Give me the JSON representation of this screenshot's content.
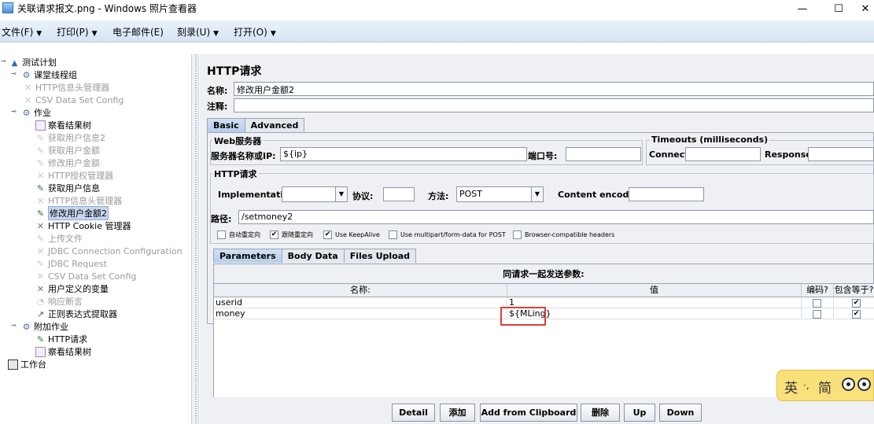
{
  "window": {
    "title": "关联请求报文.png - Windows 照片查看器",
    "minimize": "—",
    "maximize": "☐",
    "close": "✕"
  },
  "menubar": {
    "items": [
      "文件(F)",
      "打印(P)",
      "电子邮件(E)",
      "刻录(U)",
      "打开(O)"
    ]
  },
  "tree": {
    "items": [
      "测试计划",
      "课堂线程组",
      "HTTP信息头管理器",
      "CSV Data Set Config",
      "作业",
      "察看结果树",
      "获取用户信息2",
      "获取用户金额",
      "修改用户金额",
      "HTTP授权管理器",
      "获取用户信息",
      "HTTP信息头管理器",
      "修改用户金额2",
      "HTTP Cookie 管理器",
      "上传文件",
      "JDBC Connection Configuration",
      "JDBC Request",
      "CSV Data Set Config",
      "用户定义的变量",
      "响应断言",
      "正则表达式提取器",
      "附加作业",
      "HTTP请求",
      "察看结果树",
      "工作台"
    ]
  },
  "panel": {
    "title": "HTTP请求",
    "name_label": "名称:",
    "name_value": "修改用户金额2",
    "comment_label": "注释:",
    "tabs": [
      "Basic",
      "Advanced"
    ],
    "web_server": {
      "title": "Web服务器",
      "server_label": "服务器名称或IP:",
      "server_value": "${ip}",
      "port_label": "端口号:"
    },
    "timeouts": {
      "title": "Timeouts (milliseconds)",
      "connect_label": "Connect:",
      "response_label": "Response:"
    },
    "http_request": {
      "title": "HTTP请求",
      "implementation_label": "Implementation:",
      "protocol_label": "协议:",
      "method_label": "方法:",
      "method_value": "POST",
      "encoding_label": "Content encoding:",
      "path_label": "路径:",
      "path_value": "/setmoney2"
    },
    "checkboxes": [
      {
        "label": "自动重定向",
        "checked": false,
        "mark": ""
      },
      {
        "label": "跟随重定向",
        "checked": true,
        "mark": "✔"
      },
      {
        "label": "Use KeepAlive",
        "checked": true,
        "mark": "✔"
      },
      {
        "label": "Use multipart/form-data for POST",
        "checked": false,
        "mark": ""
      },
      {
        "label": "Browser-compatible headers",
        "checked": false,
        "mark": ""
      }
    ],
    "param_tabs": [
      "Parameters",
      "Body Data",
      "Files Upload"
    ],
    "params": {
      "caption": "同请求一起发送参数:",
      "headers": [
        "名称:",
        "值",
        "编码?",
        "包含等于?"
      ],
      "rows": [
        {
          "name": "userid",
          "value": "1",
          "encode_mark": "",
          "include_mark": "✔"
        },
        {
          "name": "money",
          "value": "${MLing}",
          "encode_mark": "",
          "include_mark": "✔"
        }
      ]
    },
    "buttons": [
      "Detail",
      "添加",
      "Add from Clipboard",
      "删除",
      "Up",
      "Down"
    ]
  },
  "ime": {
    "lang": "英",
    "sep": "·,",
    "mode": "简"
  }
}
